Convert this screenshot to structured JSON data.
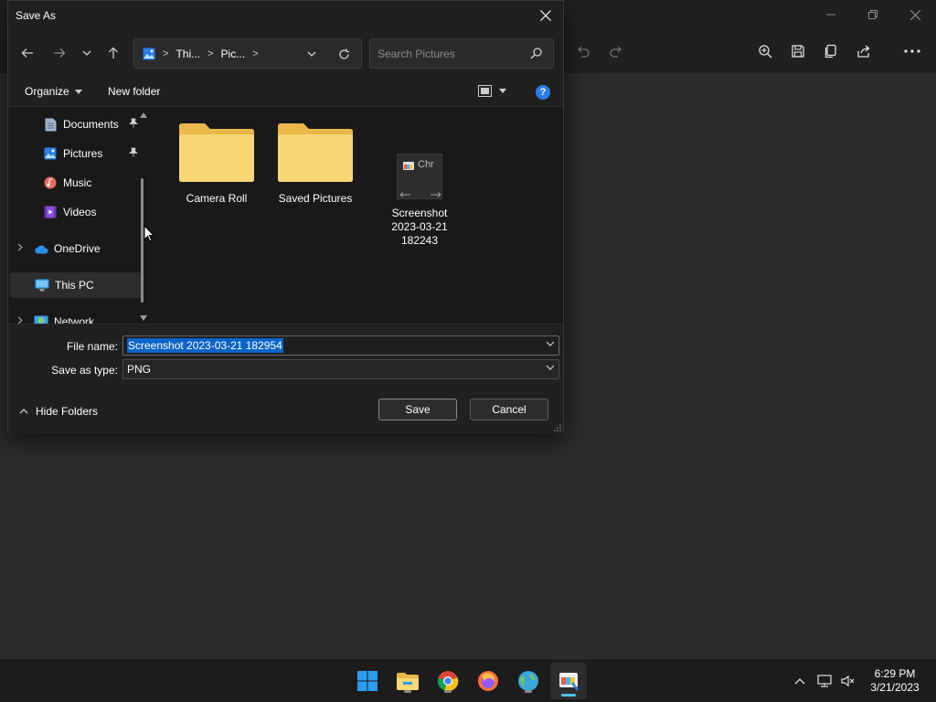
{
  "dialog": {
    "title": "Save As",
    "breadcrumbs": [
      "Thi...",
      "Pic..."
    ],
    "search_placeholder": "Search Pictures",
    "organize_label": "Organize",
    "new_folder_label": "New folder",
    "help_label": "?"
  },
  "nav_pane": {
    "items": [
      {
        "label": "Documents",
        "icon": "documents-icon",
        "pinned": true
      },
      {
        "label": "Pictures",
        "icon": "pictures-icon",
        "pinned": true
      },
      {
        "label": "Music",
        "icon": "music-icon",
        "pinned": false
      },
      {
        "label": "Videos",
        "icon": "videos-icon",
        "pinned": false
      },
      {
        "label": "OneDrive",
        "icon": "onedrive-icon",
        "pinned": false
      },
      {
        "label": "This PC",
        "icon": "this-pc-icon",
        "pinned": false
      },
      {
        "label": "Network",
        "icon": "network-icon",
        "pinned": false
      }
    ]
  },
  "files": [
    {
      "label": "Camera Roll",
      "type": "folder"
    },
    {
      "label": "Saved Pictures",
      "type": "folder"
    },
    {
      "label": "Screenshot 2023-03-21 182243",
      "type": "image",
      "thumb_text": "Chr"
    }
  ],
  "form": {
    "file_name_label": "File name:",
    "file_name_value": "Screenshot 2023-03-21 182954",
    "save_type_label": "Save as type:",
    "save_type_value": "PNG",
    "hide_folders_label": "Hide Folders",
    "save_label": "Save",
    "cancel_label": "Cancel"
  },
  "taskbar": {
    "time": "6:29 PM",
    "date": "3/21/2023"
  },
  "colors": {
    "accent": "#4cc2ff",
    "selection": "#0a64c9",
    "folder": "#f8d775"
  }
}
